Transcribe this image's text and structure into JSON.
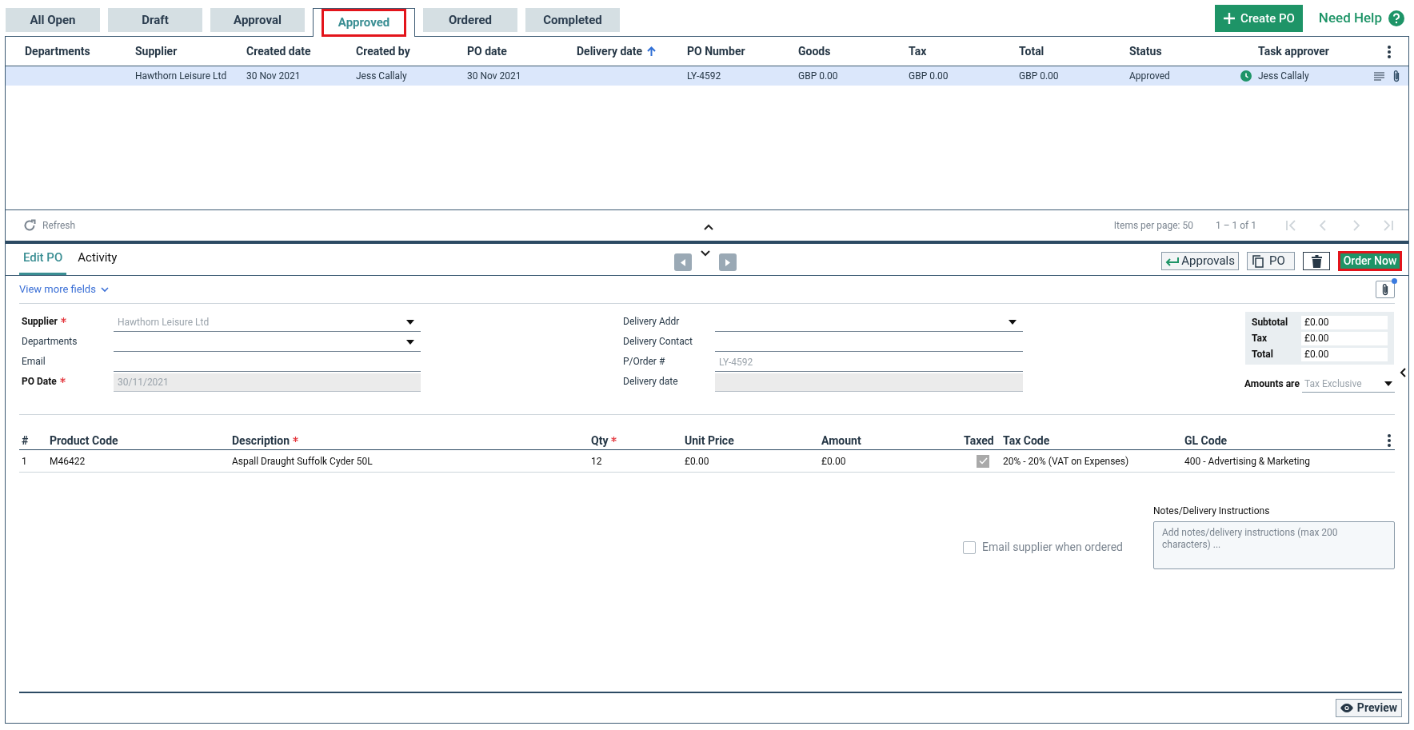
{
  "status_tabs": [
    {
      "label": "All Open",
      "selected": false,
      "highlighted": false
    },
    {
      "label": "Draft",
      "selected": false,
      "highlighted": false
    },
    {
      "label": "Approval",
      "selected": false,
      "highlighted": false
    },
    {
      "label": "Approved",
      "selected": true,
      "highlighted": true
    },
    {
      "label": "Ordered",
      "selected": false,
      "highlighted": false
    },
    {
      "label": "Completed",
      "selected": false,
      "highlighted": false
    }
  ],
  "create_button": "Create PO",
  "help_link": "Need Help",
  "orders_table": {
    "columns": [
      {
        "label": "Departments",
        "sorted": false
      },
      {
        "label": "Supplier",
        "sorted": false
      },
      {
        "label": "Created date",
        "sorted": false
      },
      {
        "label": "Created by",
        "sorted": false
      },
      {
        "label": "PO date",
        "sorted": false
      },
      {
        "label": "Delivery date",
        "sorted": true
      },
      {
        "label": "PO Number",
        "sorted": false
      },
      {
        "label": "Goods",
        "sorted": false
      },
      {
        "label": "Tax",
        "sorted": false
      },
      {
        "label": "Total",
        "sorted": false
      },
      {
        "label": "Status",
        "sorted": false
      },
      {
        "label": "Task approver",
        "sorted": false
      }
    ],
    "rows": [
      {
        "selected": true,
        "cells": [
          null,
          "Hawthorn Leisure Ltd",
          "30 Nov 2021",
          "Jess Callaly",
          "30 Nov 2021",
          null,
          "LY-4592",
          "GBP 0.00",
          "GBP 0.00",
          "GBP 0.00",
          "Approved",
          "Jess Callaly"
        ]
      }
    ]
  },
  "pager": {
    "refresh": "Refresh",
    "items_per_page": "Items per page: 50",
    "range": "1 – 1 of 1"
  },
  "detail_tabs": [
    {
      "label": "Edit PO",
      "selected": true
    },
    {
      "label": "Activity",
      "selected": false
    }
  ],
  "actions": [
    {
      "kind": "return",
      "label": "Approvals",
      "highlighted": false
    },
    {
      "kind": "copy",
      "label": "PO",
      "highlighted": false
    },
    {
      "kind": "delete",
      "highlighted": false
    },
    {
      "kind": "primary",
      "label": "Order Now",
      "highlighted": true
    }
  ],
  "view_more": "View more fields",
  "has_attachments": true,
  "form_left": [
    {
      "label": "Supplier",
      "required": true,
      "kind": "dropdown",
      "value": "Hawthorn Leisure Ltd",
      "disabled": false
    },
    {
      "label": "Departments",
      "required": false,
      "kind": "dropdown",
      "disabled": false
    },
    {
      "label": "Email",
      "required": false,
      "kind": "text",
      "disabled": false
    },
    {
      "label": "PO Date",
      "required": true,
      "kind": "text",
      "value": "30/11/2021",
      "disabled": true
    }
  ],
  "form_right": [
    {
      "label": "Delivery Addr",
      "required": false,
      "kind": "dropdown",
      "disabled": false
    },
    {
      "label": "Delivery Contact",
      "required": false,
      "kind": "text",
      "disabled": false
    },
    {
      "label": "P/Order #",
      "required": false,
      "kind": "text",
      "value": "LY-4592",
      "disabled": false
    },
    {
      "label": "Delivery date",
      "required": false,
      "kind": "text",
      "disabled": true
    }
  ],
  "totals": [
    {
      "label": "Subtotal",
      "value": "£0.00"
    },
    {
      "label": "Tax",
      "value": "£0.00"
    },
    {
      "label": "Total",
      "value": "£0.00"
    }
  ],
  "amounts_are": {
    "label": "Amounts are",
    "value": "Tax Exclusive"
  },
  "line_items": {
    "columns": [
      {
        "label": "#",
        "required": false,
        "kind": "text"
      },
      {
        "label": "Product Code",
        "required": false,
        "kind": "text"
      },
      {
        "label": "Description",
        "required": true,
        "kind": "text"
      },
      {
        "label": "Qty",
        "required": true,
        "kind": "text"
      },
      {
        "label": "Unit Price",
        "required": false,
        "kind": "text"
      },
      {
        "label": "Amount",
        "required": false,
        "kind": "text"
      },
      {
        "label": "Taxed",
        "required": false,
        "kind": "checkbox"
      },
      {
        "label": "Tax Code",
        "required": false,
        "kind": "text"
      },
      {
        "label": "GL Code",
        "required": false,
        "kind": "text"
      }
    ],
    "rows": [
      {
        "taxed": true,
        "cells": [
          "1",
          "M46422",
          "Aspall Draught Suffolk Cyder 50L",
          "12",
          "£0.00",
          "£0.00",
          null,
          "20% - 20% (VAT on Expenses)",
          "400 - Advertising & Marketing"
        ]
      }
    ]
  },
  "email_supplier": {
    "label": "Email supplier when ordered",
    "checked": false
  },
  "notes": {
    "label": "Notes/Delivery Instructions",
    "placeholder": "Add notes/delivery instructions (max 200 characters) ..."
  },
  "preview_button": "Preview"
}
